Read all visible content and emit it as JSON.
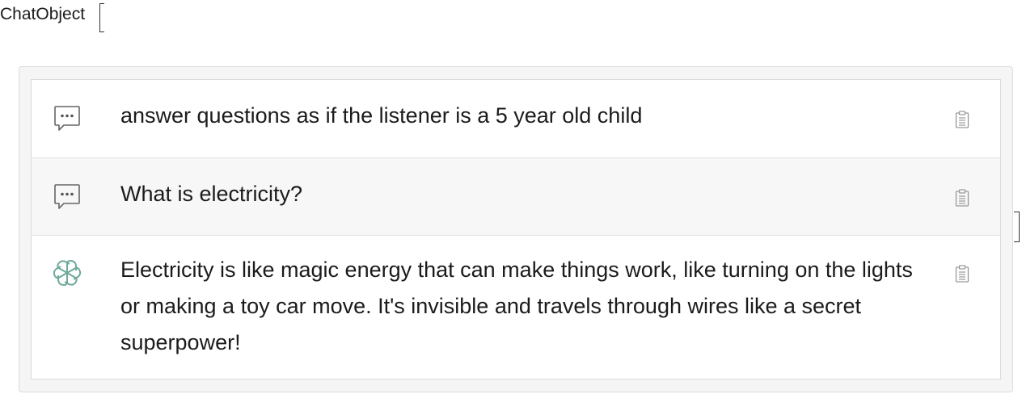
{
  "header": {
    "title": "ChatObject"
  },
  "messages": [
    {
      "role": "system",
      "icon": "speech-bubble-icon",
      "text": "answer questions as if the listener is a 5 year old child"
    },
    {
      "role": "user",
      "icon": "speech-bubble-icon",
      "text": "What is electricity?"
    },
    {
      "role": "assistant",
      "icon": "openai-logo-icon",
      "text": "Electricity is like magic energy that can make things work, like turning on the lights or making a toy car move. It's invisible and travels through wires like a secret superpower!"
    }
  ],
  "colors": {
    "icon_gray": "#666666",
    "assistant_logo": "#6fa99b",
    "panel_bg": "#f5f5f5",
    "highlight_row": "#f7f7f7"
  }
}
